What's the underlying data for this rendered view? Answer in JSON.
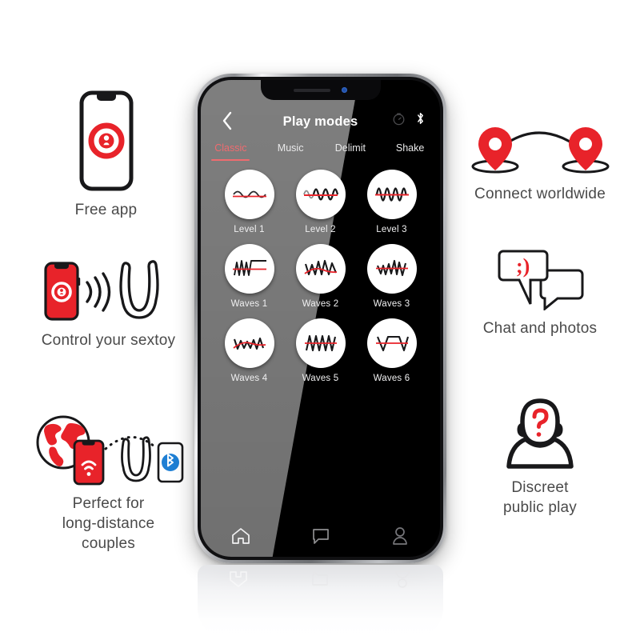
{
  "colors": {
    "brand_red": "#E8232A",
    "accent_pink": "#EF6B6F",
    "caption_gray": "#4A4A4A",
    "screen_black": "#000000",
    "bluetooth_blue": "#1E7FD4"
  },
  "phone_app": {
    "nav": {
      "back_icon": "chevron-left-icon",
      "title": "Play modes",
      "timer_icon": "timer-icon",
      "bluetooth_icon": "bluetooth-icon"
    },
    "tabs": [
      {
        "label": "Classic",
        "active": true
      },
      {
        "label": "Music",
        "active": false
      },
      {
        "label": "Delimit",
        "active": false
      },
      {
        "label": "Shake",
        "active": false
      }
    ],
    "modes": [
      {
        "label": "Level 1",
        "wave": "sine-low"
      },
      {
        "label": "Level 2",
        "wave": "sine-mid"
      },
      {
        "label": "Level 3",
        "wave": "sine-high"
      },
      {
        "label": "Waves 1",
        "wave": "zigzag-plateau"
      },
      {
        "label": "Waves 2",
        "wave": "zigzag-descend"
      },
      {
        "label": "Waves 3",
        "wave": "zigzag-mixed"
      },
      {
        "label": "Waves 4",
        "wave": "zigzag-small"
      },
      {
        "label": "Waves 5",
        "wave": "sawtooth"
      },
      {
        "label": "Waves 6",
        "wave": "v-plateau-v"
      }
    ],
    "bottom_tabs": [
      {
        "name": "home",
        "icon": "home-icon",
        "active": true
      },
      {
        "name": "chat",
        "icon": "chat-bubble-icon",
        "active": false
      },
      {
        "name": "profile",
        "icon": "person-icon",
        "active": false
      }
    ]
  },
  "features": {
    "free_app": {
      "caption": "Free app",
      "icon": "phone-with-app-logo-icon"
    },
    "control_sextoy": {
      "caption": "Control your sextoy",
      "icon": "phone-signal-toy-icon"
    },
    "long_distance": {
      "caption": "Perfect for\nlong-distance\ncouples",
      "icon": "globe-phone-toy-bluetooth-icon"
    },
    "connect_worldwide": {
      "caption": "Connect worldwide",
      "icon": "two-map-pins-arc-icon"
    },
    "chat_photos": {
      "caption": "Chat and photos",
      "icon": "speech-bubbles-wink-icon",
      "emoticon": ";)"
    },
    "discreet_play": {
      "caption": "Discreet\npublic play",
      "icon": "person-question-mark-icon"
    }
  }
}
